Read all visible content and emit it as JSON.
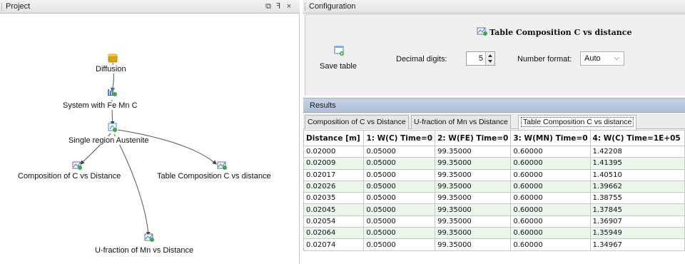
{
  "project": {
    "title": "Project",
    "restore_glyph": "⧉",
    "pin_glyph": "ꟻ",
    "close_glyph": "×",
    "nodes": {
      "diffusion": "Diffusion",
      "system": "System with Fe Mn C",
      "single_region": "Single region Austenite",
      "composition_plot": "Composition of C vs Distance",
      "table_composition": "Table Composition C vs distance",
      "u_fraction": "U-fraction of Mn vs Distance"
    }
  },
  "configuration": {
    "title": "Configuration",
    "table_title": "Table Composition C vs distance",
    "save_label": "Save table",
    "decimal_digits_label": "Decimal digits:",
    "decimal_digits_value": "5",
    "number_format_label": "Number format:",
    "number_format_value": "Auto"
  },
  "results": {
    "title": "Results",
    "tabs": [
      {
        "label": "Composition of C vs Distance",
        "active": false
      },
      {
        "label": "U-fraction of Mn vs Distance",
        "active": false
      },
      {
        "label": "Table Composition C vs distance",
        "active": true
      }
    ],
    "columns": [
      "Distance [m]",
      "1: W(C) Time=0",
      "2: W(FE) Time=0",
      "3: W(MN) Time=0",
      "4: W(C) Time=1E+05"
    ],
    "rows": [
      [
        "0.02000",
        "0.05000",
        "99.35000",
        "0.60000",
        "1.42208"
      ],
      [
        "0.02009",
        "0.05000",
        "99.35000",
        "0.60000",
        "1.41395"
      ],
      [
        "0.02017",
        "0.05000",
        "99.35000",
        "0.60000",
        "1.40510"
      ],
      [
        "0.02026",
        "0.05000",
        "99.35000",
        "0.60000",
        "1.39662"
      ],
      [
        "0.02035",
        "0.05000",
        "99.35000",
        "0.60000",
        "1.38755"
      ],
      [
        "0.02045",
        "0.05000",
        "99.35000",
        "0.60000",
        "1.37845"
      ],
      [
        "0.02054",
        "0.05000",
        "99.35000",
        "0.60000",
        "1.36907"
      ],
      [
        "0.02064",
        "0.05000",
        "99.35000",
        "0.60000",
        "1.35949"
      ],
      [
        "0.02074",
        "0.05000",
        "99.35000",
        "0.60000",
        "1.34967"
      ]
    ]
  },
  "colors": {
    "row_alt": "#eaf7ea",
    "results_header": "#b8c8de",
    "folder_icon": "#d9a21b",
    "plot_icon_accent": "#3c8dd8",
    "node_badge": "#3fa64a"
  },
  "icons": {
    "diffusion": "folder-icon",
    "system": "system-icon",
    "single_region": "calculation-icon",
    "plots": "plot-icon",
    "save": "save-table-icon"
  }
}
